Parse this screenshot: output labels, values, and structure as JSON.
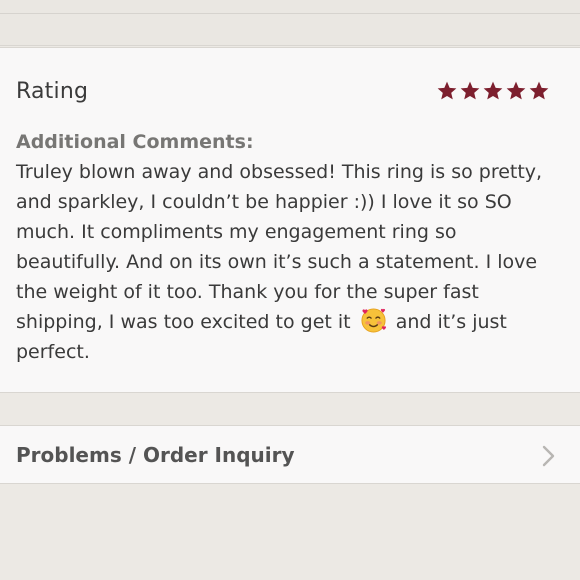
{
  "rating": {
    "label": "Rating",
    "stars": 5,
    "star_color": "#7d1f2e"
  },
  "comments": {
    "title": "Additional Comments:",
    "text_before_emoji": "Truley blown away and obsessed! This ring is so pretty, and sparkley, I couldn’t be happier :)) I love it so SO much. It compliments my engagement ring so beautifully. And on its own it’s such a statement. I love the weight of it too. Thank you for the super fast shipping, I was too excited to get it",
    "emoji_icon": "smiling-face-with-hearts-icon",
    "text_after_emoji": "and it’s just perfect."
  },
  "problems": {
    "label": "Problems / Order Inquiry",
    "chevron_icon": "chevron-right-icon"
  }
}
